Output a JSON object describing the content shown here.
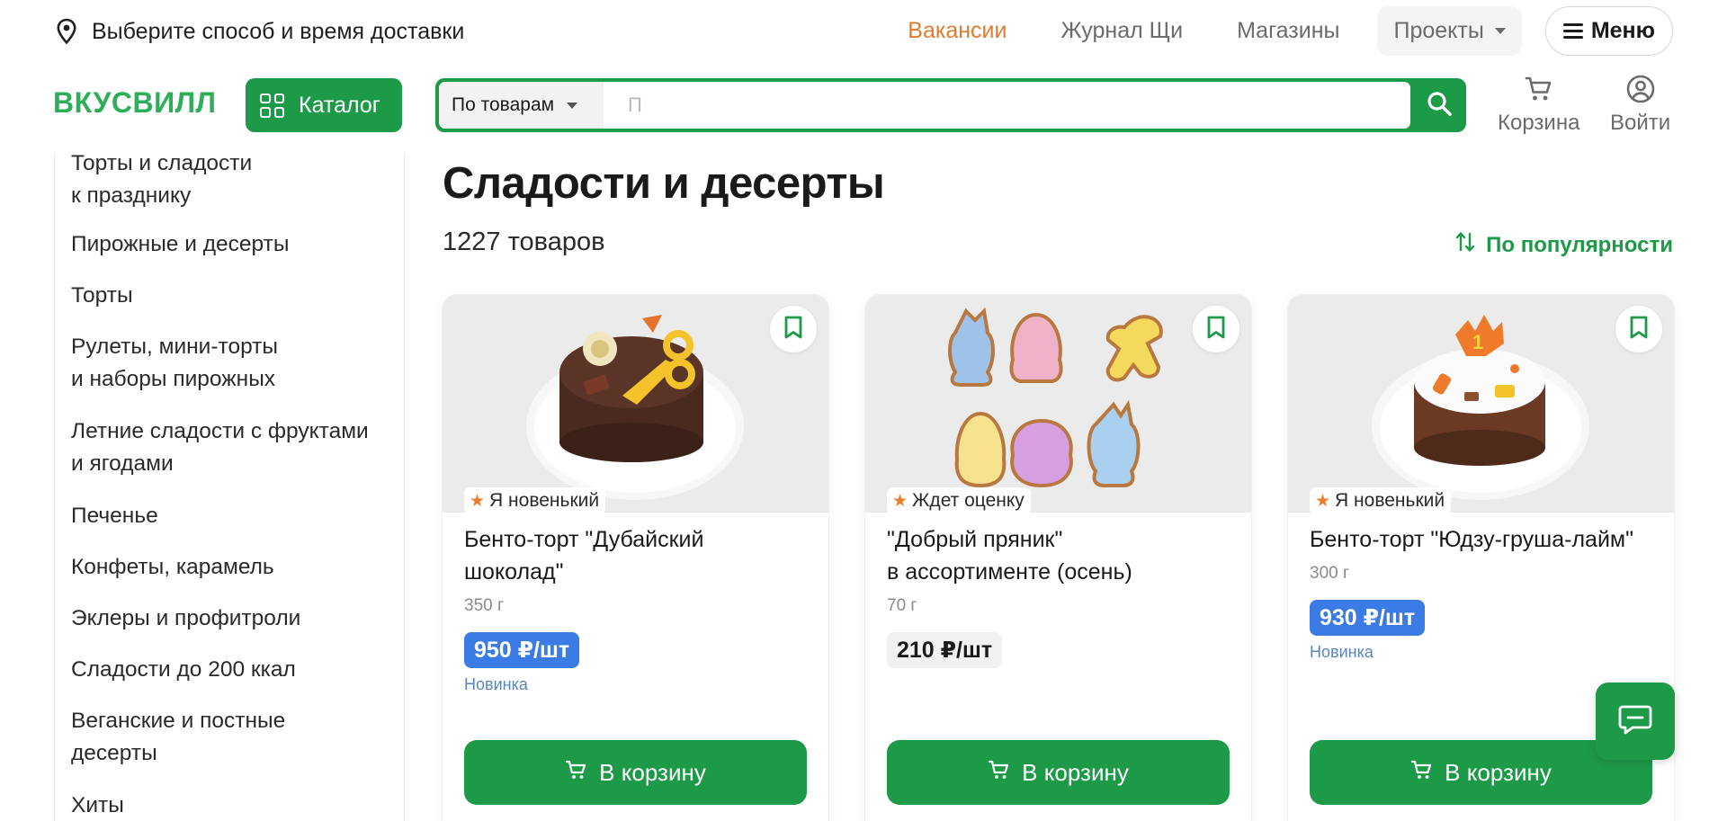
{
  "topbar": {
    "delivery_text": "Выберите способ и время доставки",
    "links": [
      "Вакансии",
      "Журнал Щи",
      "Магазины"
    ],
    "projects_label": "Проекты",
    "menu_label": "Меню"
  },
  "header": {
    "logo": "ВКУСВИЛЛ",
    "catalog_label": "Каталог",
    "search": {
      "scope": "По товарам",
      "placeholder": "П",
      "value": ""
    },
    "cart_label": "Корзина",
    "login_label": "Войти"
  },
  "sidebar": {
    "items": [
      "Торты и сладости\nк празднику",
      "Пирожные и десерты",
      "Торты",
      "Рулеты, мини-торты\nи наборы пирожных",
      "Летние сладости с фруктами\nи ягодами",
      "Печенье",
      "Конфеты, карамель",
      "Эклеры и профитроли",
      "Сладости до 200 ккал",
      "Веганские и постные\nдесерты",
      "Хиты"
    ]
  },
  "main": {
    "title": "Сладости и десерты",
    "count": "1227 товаров",
    "sort_label": "По популярности"
  },
  "products": [
    {
      "badge": "Я новенький",
      "title": "Бенто-торт \"Дубайский\nшоколад\"",
      "weight": "350 г",
      "price": "950 ₽/шт",
      "price_style": "blue",
      "tag": "Новинка",
      "button": "В корзину"
    },
    {
      "badge": "Ждет оценку",
      "title": "\"Добрый пряник\"\nв ассортименте (осень)",
      "weight": "70 г",
      "price": "210 ₽/шт",
      "price_style": "gray",
      "tag": "",
      "button": "В корзину"
    },
    {
      "badge": "Я новенький",
      "title": "Бенто-торт \"Юдзу-груша-лайм\"",
      "weight": "300 г",
      "price": "930 ₽/шт",
      "price_style": "blue",
      "tag": "Новинка",
      "button": "В корзину"
    }
  ],
  "colors": {
    "brand_green": "#1d9a48",
    "logo_green": "#2fae5a",
    "accent_orange": "#e37a2e",
    "price_blue": "#3a7be6"
  },
  "icons": [
    "location-pin-icon",
    "grid-icon",
    "search-icon",
    "cart-icon",
    "user-icon",
    "sort-icon",
    "bookmark-icon",
    "star-icon",
    "chat-icon"
  ]
}
